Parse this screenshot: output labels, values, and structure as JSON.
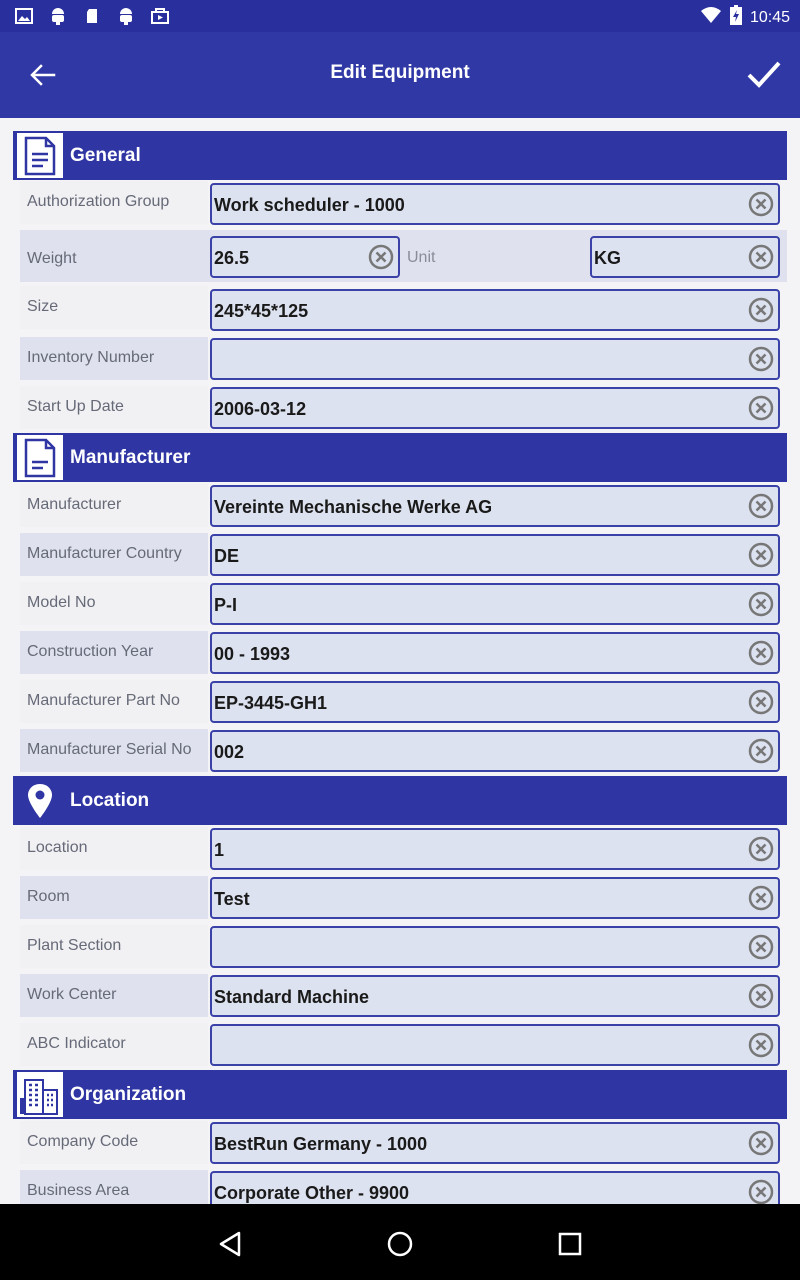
{
  "status_bar": {
    "time": "10:45",
    "left_icons": [
      "image-icon",
      "android-icon",
      "sd-card-icon",
      "android-debug-icon",
      "store-icon"
    ],
    "right_icons": [
      "wifi-icon",
      "battery-charging-icon"
    ]
  },
  "app_bar": {
    "title": "Edit Equipment",
    "back_icon": "arrow-left-icon",
    "done_icon": "checkmark-icon"
  },
  "sections": {
    "general": {
      "title": "General",
      "icon": "document-icon",
      "rows": {
        "authorization_group": {
          "label": "Authorization Group",
          "value": "Work scheduler - 1000"
        },
        "weight": {
          "label": "Weight",
          "value": "26.5"
        },
        "unit": {
          "label": "Unit",
          "value": "KG"
        },
        "size": {
          "label": "Size",
          "value": "245*45*125"
        },
        "inventory_number": {
          "label": "Inventory Number",
          "value": ""
        },
        "start_up_date": {
          "label": "Start Up Date",
          "value": "2006-03-12"
        }
      }
    },
    "manufacturer": {
      "title": "Manufacturer",
      "icon": "document-icon",
      "rows": {
        "manufacturer": {
          "label": "Manufacturer",
          "value": "Vereinte Mechanische Werke AG"
        },
        "manufacturer_country": {
          "label": "Manufacturer Country",
          "value": "DE"
        },
        "model_no": {
          "label": "Model No",
          "value": "P-I"
        },
        "construction_year": {
          "label": "Construction Year",
          "value": "00 - 1993"
        },
        "manufacturer_part_no": {
          "label": "Manufacturer Part No",
          "value": "EP-3445-GH1"
        },
        "manufacturer_serial_no": {
          "label": "Manufacturer Serial No",
          "value": "002"
        }
      }
    },
    "location": {
      "title": "Location",
      "icon": "map-pin-icon",
      "rows": {
        "location": {
          "label": "Location",
          "value": "1"
        },
        "room": {
          "label": "Room",
          "value": "Test"
        },
        "plant_section": {
          "label": "Plant Section",
          "value": ""
        },
        "work_center": {
          "label": "Work Center",
          "value": "Standard Machine"
        },
        "abc_indicator": {
          "label": "ABC Indicator",
          "value": ""
        }
      }
    },
    "organization": {
      "title": "Organization",
      "icon": "building-icon",
      "rows": {
        "company_code": {
          "label": "Company Code",
          "value": "BestRun Germany - 1000"
        },
        "business_area": {
          "label": "Business Area",
          "value": "Corporate Other - 9900"
        }
      }
    }
  },
  "colors": {
    "status_bar": "#2a2f9e",
    "app_bar": "#3038a6",
    "section_header": "#2f35a3",
    "field_border": "#3a42a8",
    "field_fill": "#dde2f0"
  }
}
